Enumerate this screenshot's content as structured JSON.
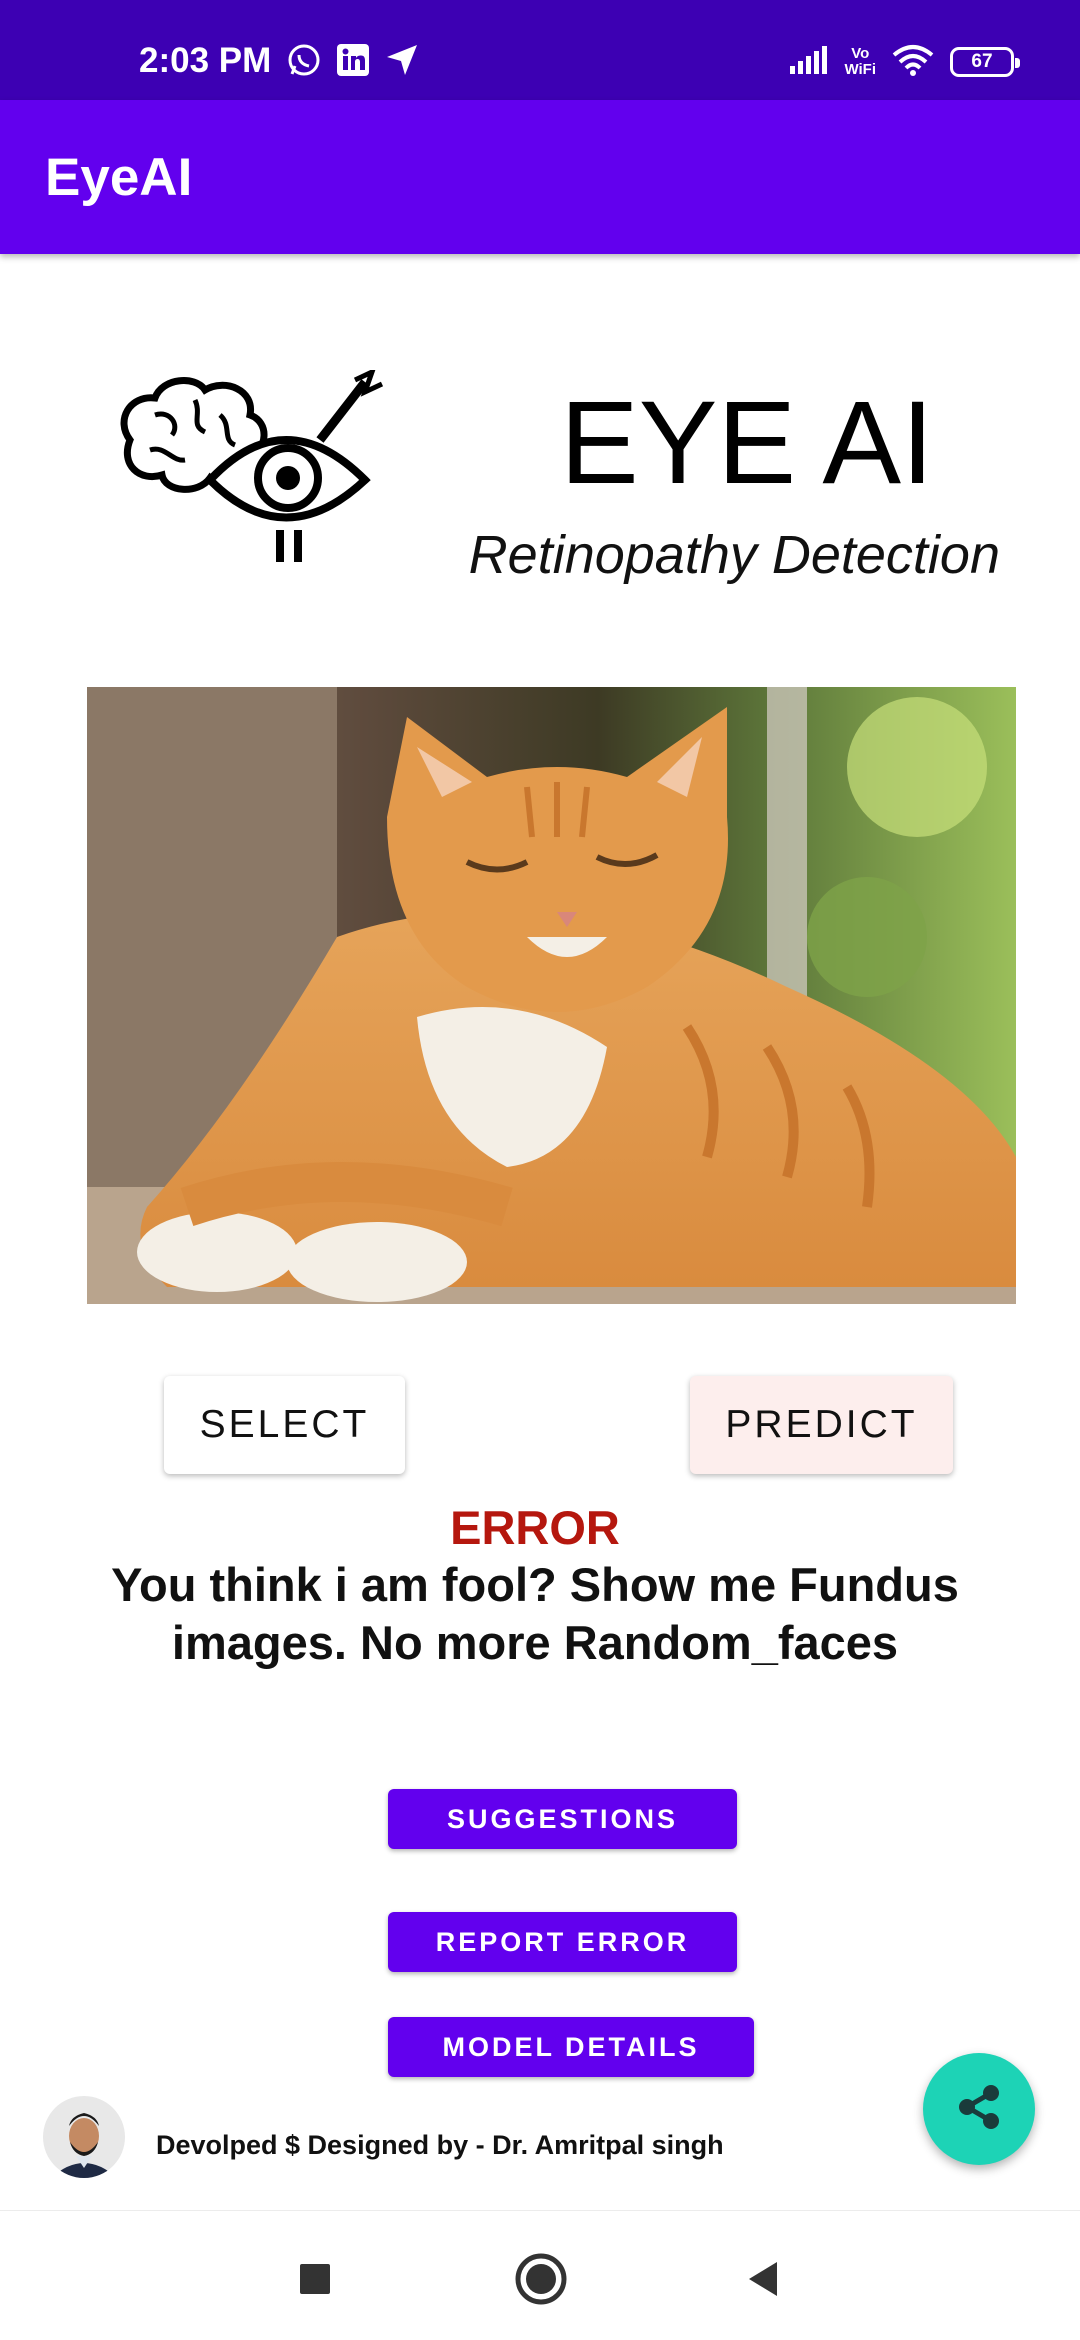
{
  "status_bar": {
    "time": "2:03 PM",
    "battery": "67",
    "network_label_top": "Vo",
    "network_label_bottom": "WiFi",
    "icons_left": [
      "whatsapp-icon",
      "linkedin-icon",
      "location-arrow-icon"
    ],
    "icons_right": [
      "signal-icon",
      "vowifi-icon",
      "wifi-icon",
      "battery-icon"
    ]
  },
  "app_bar": {
    "title": "EyeAI"
  },
  "header": {
    "title": "EYE AI",
    "subtitle": "Retinopathy Detection",
    "logo_icon": "brain-eye-logo"
  },
  "actions": {
    "select_label": "SELECT",
    "predict_label": "PREDICT"
  },
  "result": {
    "title": "ERROR",
    "message": "You think i am fool? Show me Fundus images. No more Random_faces"
  },
  "buttons": {
    "suggestions_label": "SUGGESTIONS",
    "report_error_label": "REPORT ERROR",
    "model_details_label": "MODEL DETAILS"
  },
  "footer": {
    "credit": "Devolped $ Designed by - Dr. Amritpal singh"
  },
  "fab": {
    "icon": "share-icon"
  },
  "nav_bar": {
    "icons": [
      "recents-square-icon",
      "home-circle-icon",
      "back-triangle-icon"
    ]
  },
  "colors": {
    "status_bar": "#3d00b3",
    "app_bar": "#6200ee",
    "error": "#b5170e",
    "fab": "#1dd3b6",
    "predict_button": "#fdeeed"
  }
}
